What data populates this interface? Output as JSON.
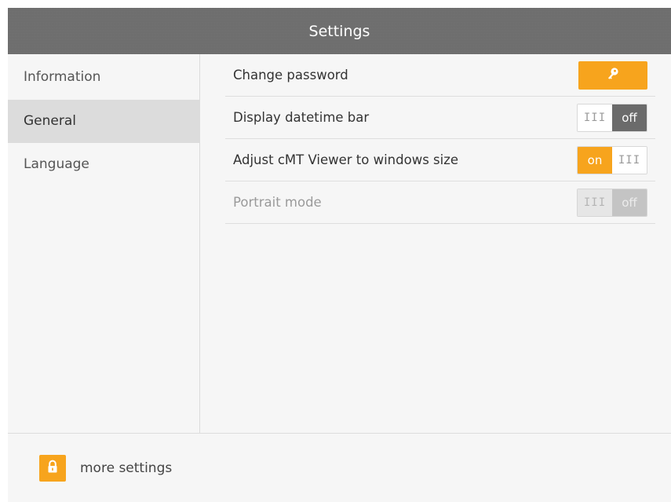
{
  "window": {
    "title": "Settings"
  },
  "sidebar": {
    "items": [
      {
        "label": "Information",
        "active": false
      },
      {
        "label": "General",
        "active": true
      },
      {
        "label": "Language",
        "active": false
      }
    ]
  },
  "general": {
    "rows": [
      {
        "label": "Change password",
        "control": "key-button",
        "icon": "key-icon"
      },
      {
        "label": "Display datetime bar",
        "control": "toggle",
        "state": "off",
        "grip": "III",
        "state_label": "off"
      },
      {
        "label": "Adjust cMT Viewer to windows size",
        "control": "toggle",
        "state": "on",
        "grip": "III",
        "state_label": "on"
      },
      {
        "label": "Portrait mode",
        "control": "toggle",
        "state": "off",
        "disabled": true,
        "grip": "III",
        "state_label": "off"
      }
    ]
  },
  "footer": {
    "more_settings_label": "more settings",
    "icon": "lock-icon"
  },
  "colors": {
    "accent": "#f7a41d",
    "titlebar": "#6e6e6e",
    "toggle_off": "#6b6b6b"
  }
}
